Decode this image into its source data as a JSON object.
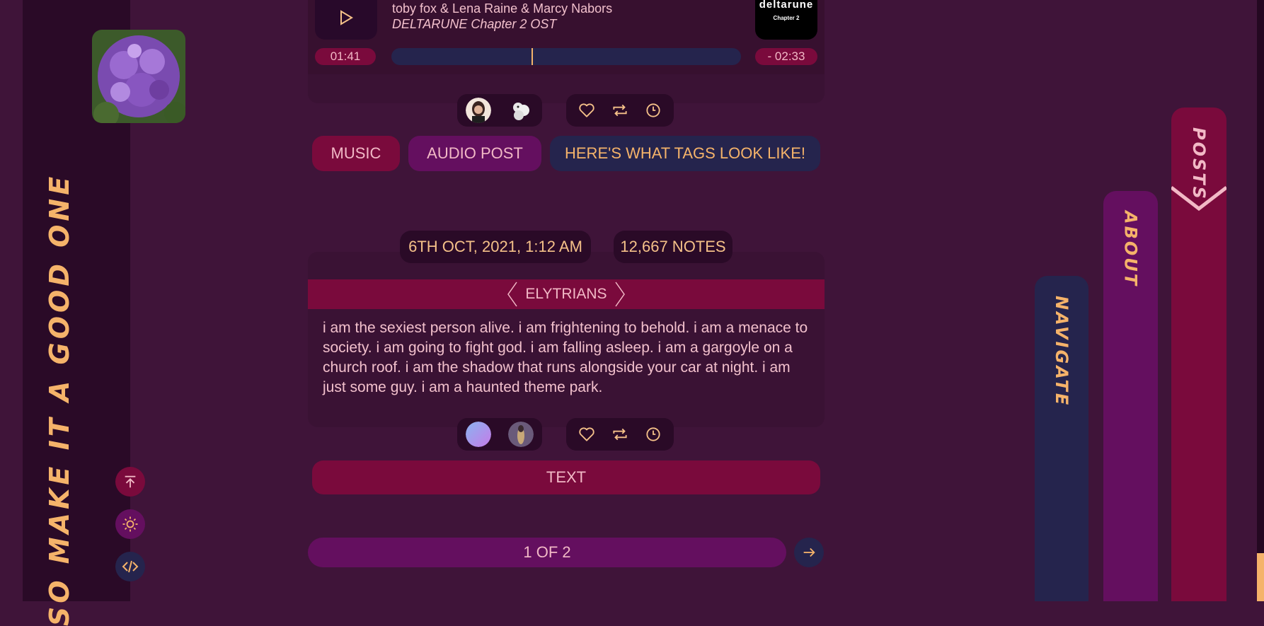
{
  "blog": {
    "title": "SO MAKE IT A GOOD ONE",
    "sidebar_buttons": [
      "scroll-to-top-icon",
      "sun-icon",
      "code-icon"
    ]
  },
  "audio_post": {
    "artist": "toby fox & Lena Raine & Marcy Nabors",
    "album": "DELTARUNE Chapter 2 OST",
    "cover_title": "deltarune",
    "cover_subtitle": "Chapter 2",
    "elapsed": "01:41",
    "remaining": "- 02:33",
    "progress": 0.4,
    "tags": [
      "MUSIC",
      "AUDIO POST",
      "HERE'S WHAT TAGS LOOK LIKE!"
    ]
  },
  "text_post": {
    "date": "6TH OCT, 2021, 1:12 AM",
    "notes": "12,667 NOTES",
    "username": "ELYTRIANS",
    "body": "i am the sexiest person alive. i am frightening to behold. i am a menace to society. i am going to fight god. i am falling asleep. i am a gargoyle on a church roof. i am the shadow that runs alongside your car at night. i am just some guy. i am a haunted theme park.",
    "type_label": "TEXT"
  },
  "actions": [
    "heart-icon",
    "reblog-icon",
    "clock-icon"
  ],
  "pagination": {
    "label": "1 OF 2"
  },
  "nav": {
    "posts": "POSTS",
    "about": "ABOUT",
    "navigate": "NAVIGATE"
  },
  "colors": {
    "background": "#3f1439",
    "accent_gold": "#f5b36a",
    "crimson": "#7a0a3c",
    "purple": "#640f5f",
    "navy": "#25244d"
  }
}
